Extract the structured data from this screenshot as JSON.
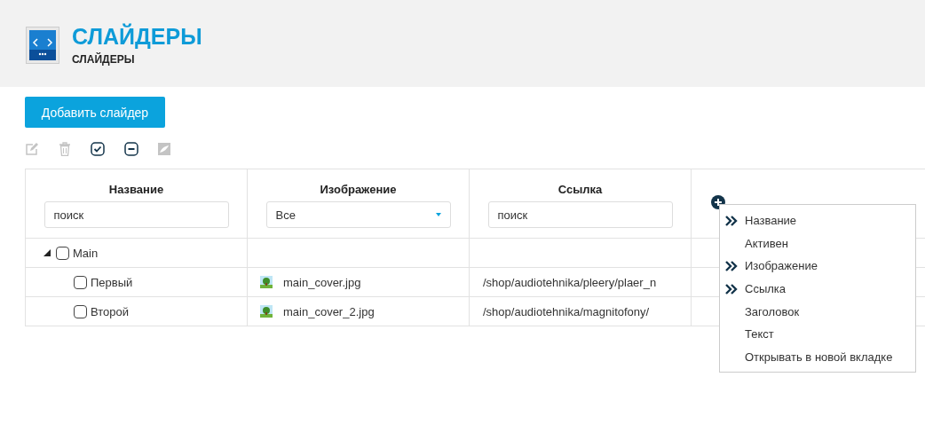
{
  "header": {
    "title": "СЛАЙДЕРЫ",
    "subtitle": "СЛАЙДЕРЫ"
  },
  "add_button": "Добавить слайдер",
  "toolbar": [
    {
      "kind": "edit",
      "disabled": true
    },
    {
      "kind": "delete",
      "disabled": true
    },
    {
      "kind": "check",
      "disabled": false
    },
    {
      "kind": "uncheck",
      "disabled": false
    },
    {
      "kind": "image",
      "disabled": true
    }
  ],
  "table": {
    "columns": [
      {
        "title": "Название",
        "filter": {
          "kind": "search",
          "placeholder": "поиск"
        }
      },
      {
        "title": "Изображение",
        "filter": {
          "kind": "select",
          "value": "Все"
        }
      },
      {
        "title": "Ссылка",
        "filter": {
          "kind": "search",
          "placeholder": "поиск"
        }
      }
    ],
    "rows": [
      {
        "name": "Main",
        "checked": false,
        "expanded": true,
        "children": [
          {
            "name": "Первый",
            "checked": false,
            "image": "main_cover.jpg",
            "link": "/shop/audiotehnika/pleery/plaer_n"
          },
          {
            "name": "Второй",
            "checked": false,
            "image": "main_cover_2.jpg",
            "link": "/shop/audiotehnika/magnitofony/"
          }
        ]
      }
    ]
  },
  "column_menu": {
    "items": [
      {
        "label": "Название",
        "checked": true
      },
      {
        "label": "Активен",
        "checked": false
      },
      {
        "label": "Изображение",
        "checked": true
      },
      {
        "label": "Ссылка",
        "checked": true
      },
      {
        "label": "Заголовок",
        "checked": false
      },
      {
        "label": "Текст",
        "checked": false
      },
      {
        "label": "Открывать в новой вкладке",
        "checked": false
      }
    ]
  }
}
